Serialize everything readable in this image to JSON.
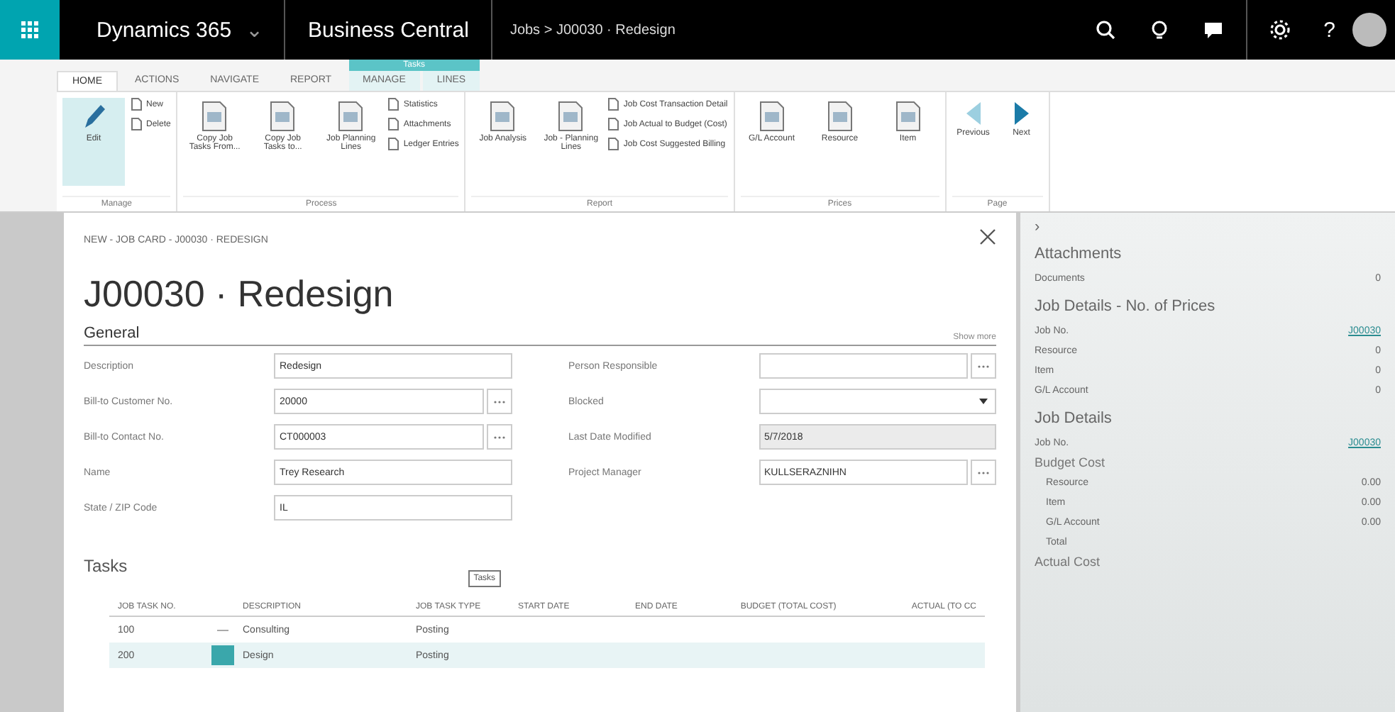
{
  "top_bar": {
    "app_launcher": true,
    "product": "Dynamics 365",
    "product_caret": "⌄",
    "app_name": "Business Central",
    "breadcrumb": "Jobs > J00030 · Redesign",
    "help": "?"
  },
  "ribbon": {
    "context_tab": "Tasks",
    "tabs": [
      {
        "label": "HOME",
        "selected": true,
        "contextual": false
      },
      {
        "label": "ACTIONS",
        "selected": false,
        "contextual": false
      },
      {
        "label": "NAVIGATE",
        "selected": false,
        "contextual": false
      },
      {
        "label": "REPORT",
        "selected": false,
        "contextual": false
      },
      {
        "label": "MANAGE",
        "selected": false,
        "contextual": true
      },
      {
        "label": "LINES",
        "selected": false,
        "contextual": true
      }
    ],
    "groups": [
      {
        "label": "Manage",
        "items": [
          {
            "label": "Edit",
            "kind": "edit"
          },
          {
            "label": "New",
            "kind": "small"
          },
          {
            "label": "Delete",
            "kind": "small"
          }
        ]
      },
      {
        "label": "Process",
        "items": [
          {
            "label": "Copy Job Tasks From...",
            "kind": "large"
          },
          {
            "label": "Copy Job Tasks to...",
            "kind": "large"
          },
          {
            "label": "Job Planning Lines",
            "kind": "large"
          },
          {
            "label": "Statistics",
            "kind": "small"
          },
          {
            "label": "Attachments",
            "kind": "small"
          },
          {
            "label": "Ledger Entries",
            "kind": "small"
          }
        ]
      },
      {
        "label": "Report",
        "items": [
          {
            "label": "Job Analysis",
            "kind": "large"
          },
          {
            "label": "Job - Planning Lines",
            "kind": "large"
          },
          {
            "label": "Job Cost Transaction Detail",
            "kind": "small"
          },
          {
            "label": "Job Actual to Budget (Cost)",
            "kind": "small"
          },
          {
            "label": "Job Cost Suggested Billing",
            "kind": "small"
          }
        ]
      },
      {
        "label": "Prices",
        "items": [
          {
            "label": "G/L Account",
            "kind": "large"
          },
          {
            "label": "Resource",
            "kind": "large"
          },
          {
            "label": "Item",
            "kind": "large"
          }
        ]
      },
      {
        "label": "Page",
        "items": [
          {
            "label": "Previous",
            "kind": "prev"
          },
          {
            "label": "Next",
            "kind": "next"
          }
        ]
      }
    ]
  },
  "card": {
    "caption": "NEW - JOB CARD - J00030 · REDESIGN",
    "title": "J00030 · Redesign",
    "general": {
      "heading": "General",
      "show_more": "Show more",
      "left_fields": [
        {
          "label": "Description",
          "value": "Redesign",
          "kind": "text"
        },
        {
          "label": "Bill-to Customer No.",
          "value": "20000",
          "kind": "lookup"
        },
        {
          "label": "Bill-to Contact No.",
          "value": "CT000003",
          "kind": "lookup"
        },
        {
          "label": "Name",
          "value": "Trey Research",
          "kind": "text"
        },
        {
          "label": "State / ZIP Code",
          "value": "IL",
          "kind": "text"
        }
      ],
      "right_fields": [
        {
          "label": "Person Responsible",
          "kind": "lookup"
        },
        {
          "label": "Blocked",
          "kind": "dropdown"
        },
        {
          "label": "Last Date Modified",
          "value": "5/7/2018",
          "kind": "readonly"
        },
        {
          "label": "Project Manager",
          "value": "KULLSERAZNIHN",
          "kind": "lookup"
        }
      ]
    },
    "tasks": {
      "heading": "Tasks",
      "tooltip": "Tasks",
      "columns": [
        "JOB TASK NO.",
        "DESCRIPTION",
        "JOB TASK TYPE",
        "START DATE",
        "END DATE",
        "BUDGET (TOTAL COST)",
        "ACTUAL (TO CC"
      ],
      "rows": [
        {
          "cells": [
            "100",
            "Consulting",
            "Posting"
          ],
          "selected": false
        },
        {
          "cells": [
            "200",
            "Design",
            "Posting"
          ],
          "selected": true
        }
      ]
    }
  },
  "factbox": {
    "collapse": "›",
    "sections": [
      {
        "title": "Attachments",
        "rows": [
          {
            "label": "Documents",
            "value": "0",
            "kind": "plain"
          }
        ]
      },
      {
        "title": "Job Details - No. of Prices",
        "rows": [
          {
            "label": "Job No.",
            "value": "J00030",
            "kind": "link"
          },
          {
            "label": "Resource",
            "value": "0",
            "kind": "plain"
          },
          {
            "label": "Item",
            "value": "0",
            "kind": "plain"
          },
          {
            "label": "G/L Account",
            "value": "0",
            "kind": "plain"
          }
        ]
      },
      {
        "title": "Job Details",
        "rows": [
          {
            "label": "Job No.",
            "value": "J00030",
            "kind": "link"
          },
          {
            "label": "Budget Cost",
            "kind": "subheading"
          },
          {
            "label": "Resource",
            "value": "0.00",
            "kind": "indented"
          },
          {
            "label": "Item",
            "value": "0.00",
            "kind": "indented"
          },
          {
            "label": "G/L Account",
            "value": "0.00",
            "kind": "indented"
          },
          {
            "label": "Total",
            "kind": "indented"
          },
          {
            "label": "Actual Cost",
            "kind": "subheading"
          }
        ]
      }
    ]
  }
}
